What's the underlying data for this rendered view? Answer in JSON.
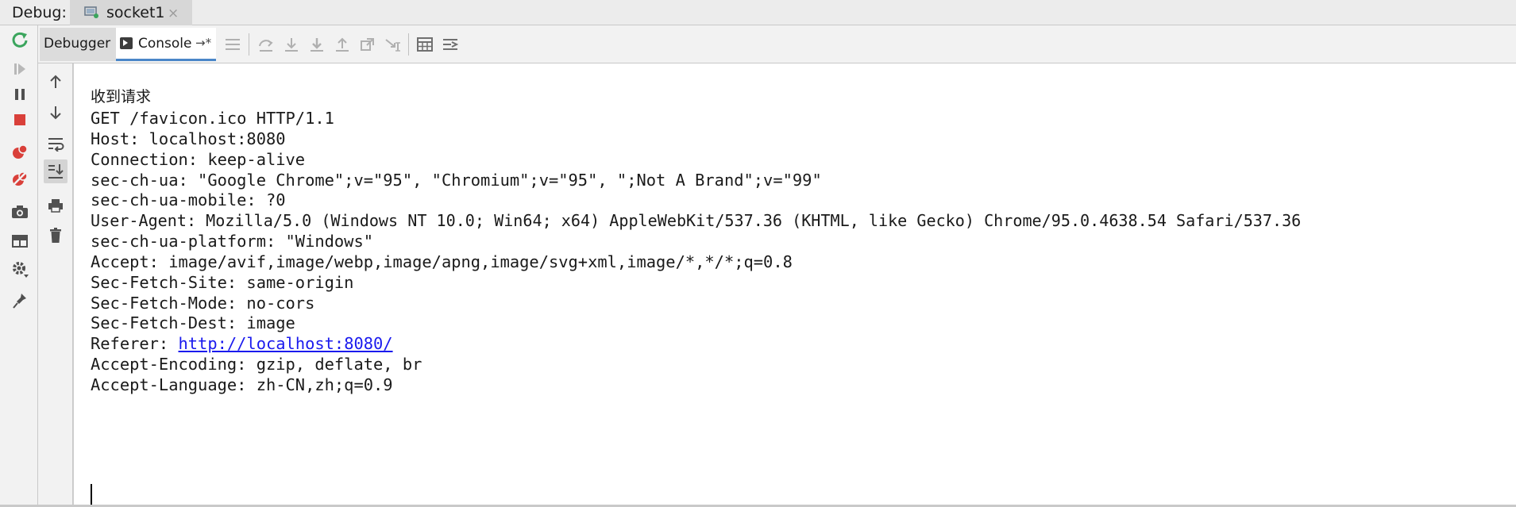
{
  "window": {
    "debug_label": "Debug:",
    "tab_name": "socket1",
    "tab_close": "×"
  },
  "toolbar": {
    "debugger_tab": "Debugger",
    "console_tab": "Console",
    "console_pin": "→*"
  },
  "console": {
    "header": "收到请求",
    "lines": [
      "GET /favicon.ico HTTP/1.1",
      "Host: localhost:8080",
      "Connection: keep-alive",
      "sec-ch-ua: \"Google Chrome\";v=\"95\", \"Chromium\";v=\"95\", \";Not A Brand\";v=\"99\"",
      "sec-ch-ua-mobile: ?0",
      "User-Agent: Mozilla/5.0 (Windows NT 10.0; Win64; x64) AppleWebKit/537.36 (KHTML, like Gecko) Chrome/95.0.4638.54 Safari/537.36",
      "sec-ch-ua-platform: \"Windows\"",
      "Accept: image/avif,image/webp,image/apng,image/svg+xml,image/*,*/*;q=0.8",
      "Sec-Fetch-Site: same-origin",
      "Sec-Fetch-Mode: no-cors",
      "Sec-Fetch-Dest: image"
    ],
    "referer_label": "Referer: ",
    "referer_url": "http://localhost:8080/",
    "lines_after": [
      "Accept-Encoding: gzip, deflate, br",
      "Accept-Language: zh-CN,zh;q=0.9"
    ]
  },
  "colors": {
    "accent": "#4a86c8",
    "rerun_green": "#3ba55d",
    "stop_red": "#d9403a",
    "link_blue": "#1a1aee"
  }
}
